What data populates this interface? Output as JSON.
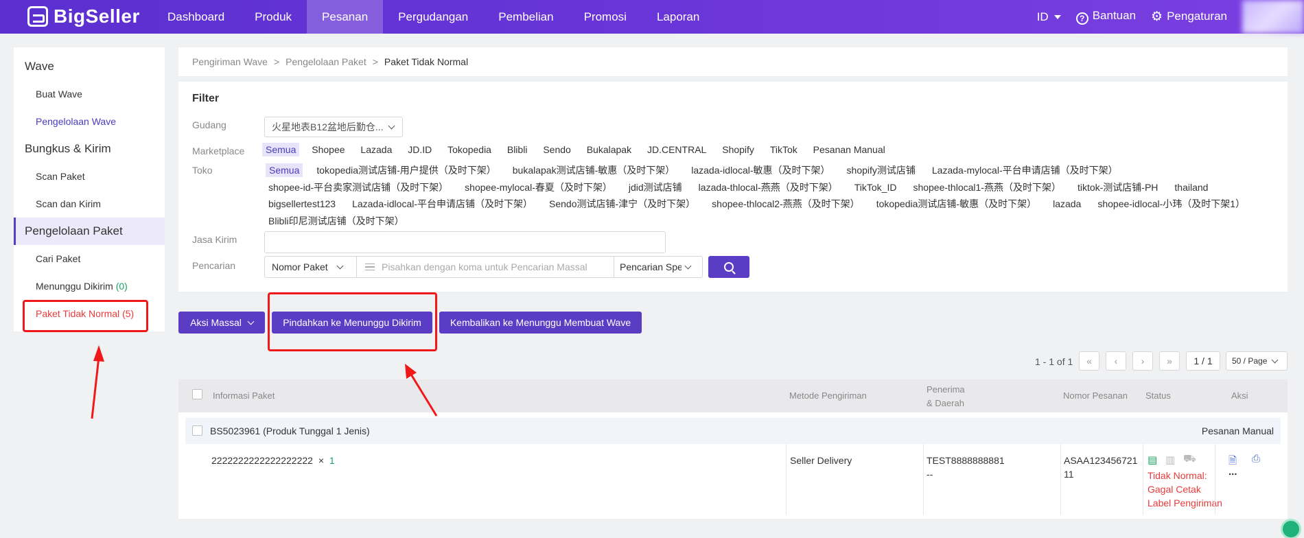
{
  "brand": {
    "name": "BigSeller"
  },
  "nav": {
    "items": [
      "Dashboard",
      "Produk",
      "Pesanan",
      "Pergudangan",
      "Pembelian",
      "Promosi",
      "Laporan"
    ],
    "active": "Pesanan",
    "lang": "ID",
    "help": "Bantuan",
    "settings": "Pengaturan"
  },
  "sidebar": {
    "group1": "Wave",
    "buat_wave": "Buat Wave",
    "pengelolaan_wave": "Pengelolaan Wave",
    "group2": "Bungkus & Kirim",
    "scan_paket": "Scan Paket",
    "scan_kirim": "Scan dan Kirim",
    "group3": "Pengelolaan Paket",
    "cari_paket": "Cari Paket",
    "menunggu": "Menunggu Dikirim",
    "menunggu_count": "(0)",
    "tidak_normal": "Paket Tidak Normal",
    "tidak_normal_count": "(5)"
  },
  "breadcrumb": {
    "c1": "Pengiriman Wave",
    "c2": "Pengelolaan Paket",
    "c3": "Paket Tidak Normal",
    "sep": ">"
  },
  "filter": {
    "title": "Filter",
    "gudang_label": "Gudang",
    "gudang_value": "火星地表B12盆地后勤仓...",
    "marketplace_label": "Marketplace",
    "marketplaces": [
      "Semua",
      "Shopee",
      "Lazada",
      "JD.ID",
      "Tokopedia",
      "Blibli",
      "Sendo",
      "Bukalapak",
      "JD.CENTRAL",
      "Shopify",
      "TikTok",
      "Pesanan Manual"
    ],
    "toko_label": "Toko",
    "stores_row1": [
      "Semua",
      "tokopedia测试店铺-用户提供（及时下架）",
      "bukalapak测试店铺-敏惠（及时下架）",
      "lazada-idlocal-敏惠（及时下架）",
      "shopify测试店铺",
      "Lazada-mylocal-平台申请店铺（及时下架）"
    ],
    "stores_row2": [
      "shopee-id-平台卖家测试店铺（及时下架）",
      "shopee-mylocal-春夏（及时下架）",
      "jdid测试店铺",
      "lazada-thlocal-燕燕（及时下架）",
      "TikTok_ID",
      "shopee-thlocal1-燕燕（及时下架）",
      "tiktok-测试店铺-PH",
      "thailand"
    ],
    "stores_row3": [
      "bigsellertest123",
      "Lazada-idlocal-平台申请店铺（及时下架）",
      "Sendo测试店铺-津宁（及时下架）",
      "shopee-thlocal2-燕燕（及时下架）",
      "tokopedia测试店铺-敏惠（及时下架）",
      "lazada",
      "shopee-idlocal-小玮（及时下架1）"
    ],
    "stores_row4": [
      "Blibli印尼测试店铺（及时下架）"
    ],
    "jasa_label": "Jasa Kirim",
    "pencarian_label": "Pencarian",
    "search_type": "Nomor Paket",
    "search_placeholder": "Pisahkan dengan koma untuk Pencarian Massal",
    "search_mode": "Pencarian Spe"
  },
  "actions": {
    "bulk": "Aksi Massal",
    "move": "Pindahkan ke Menunggu Dikirim",
    "return": "Kembalikan ke Menunggu Membuat Wave"
  },
  "pagination": {
    "range": "1 - 1 of 1",
    "first": "«",
    "prev": "‹",
    "next": "›",
    "last": "»",
    "page": "1 / 1",
    "per_page": "50 / Page"
  },
  "table": {
    "headers": {
      "info": "Informasi Paket",
      "method": "Metode Pengiriman",
      "recipient1": "Penerima",
      "recipient2": "& Daerah",
      "order": "Nomor Pesanan",
      "status": "Status",
      "action": "Aksi"
    },
    "group": {
      "package": "BS5023961 (Produk Tunggal 1 Jenis)",
      "type": "Pesanan Manual"
    },
    "row": {
      "sku": "2222222222222222222",
      "times": "×",
      "qty": "1",
      "method": "Seller Delivery",
      "recipient": "TEST8888888881",
      "region": "--",
      "order_line1": "ASAA123456721",
      "order_line2": "11",
      "status_line1": "Tidak Normal:",
      "status_line2": "Gagal Cetak",
      "status_line3": "Label Pengiriman",
      "more": "..."
    }
  },
  "colors": {
    "primary": "#5b3cc4",
    "highlight_red": "#f01818",
    "status_red": "#e83b3b",
    "count_green": "#1aa260"
  }
}
